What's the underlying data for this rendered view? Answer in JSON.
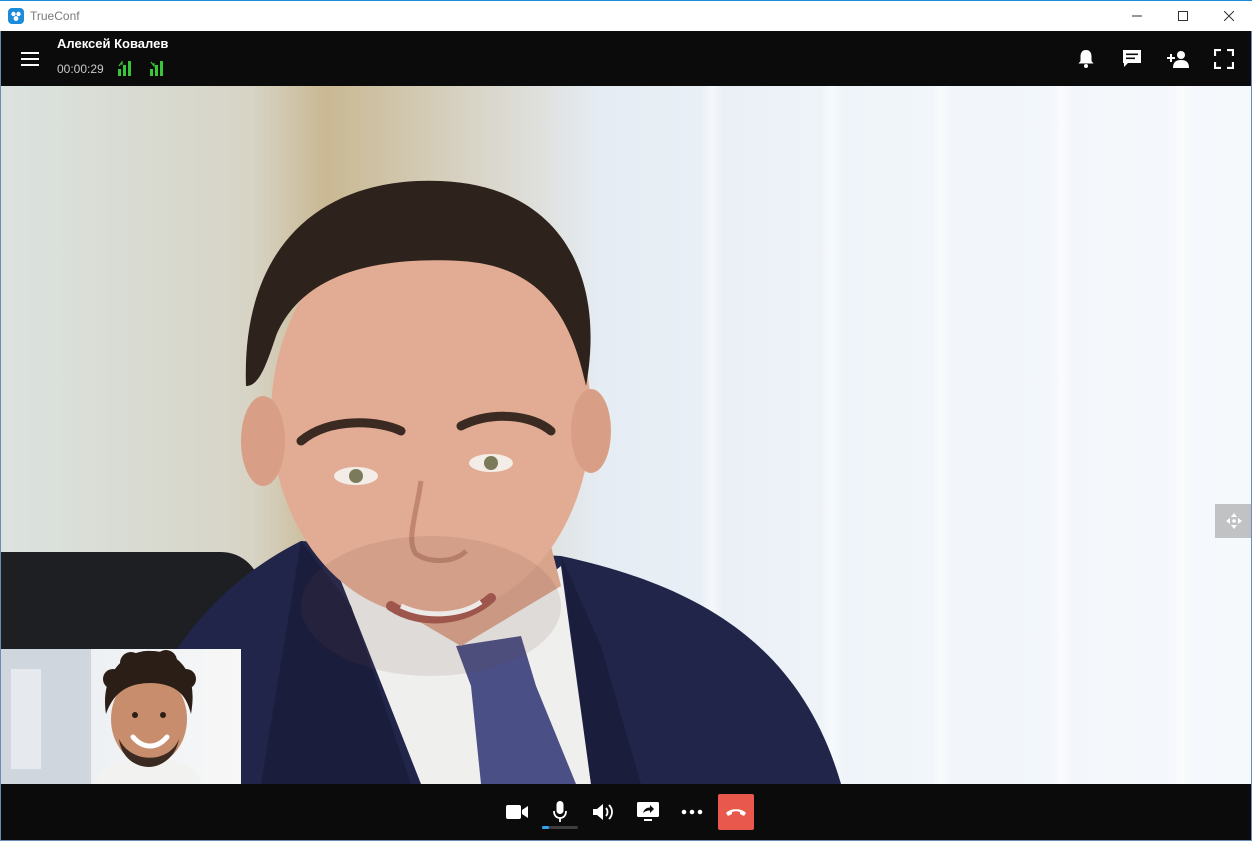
{
  "window": {
    "title": "TrueConf",
    "accent_color": "#1c8bd9"
  },
  "call": {
    "contact_name": "Алексей Ковалев",
    "duration": "00:00:29",
    "signal_color": "#3ac43a"
  },
  "header_actions": [
    "bell-icon",
    "chat-icon",
    "add-participant-icon",
    "fullscreen-icon"
  ],
  "toolbar": {
    "buttons": [
      "camera-icon",
      "microphone-icon",
      "speaker-icon",
      "screen-share-icon",
      "more-icon",
      "hang-up-icon"
    ],
    "hangup_color": "#e8584d",
    "mic_level": 0.2
  }
}
